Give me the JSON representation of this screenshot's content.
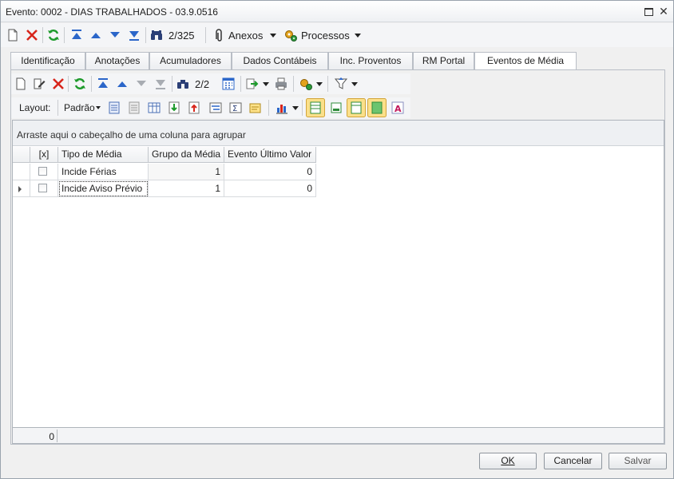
{
  "window": {
    "title": "Evento: 0002 - DIAS TRABALHADOS - 03.9.0516"
  },
  "toolbar": {
    "record_position": "2/325",
    "attachments_label": "Anexos",
    "processes_label": "Processos"
  },
  "tabs": [
    {
      "label": "Identificação"
    },
    {
      "label": "Anotações"
    },
    {
      "label": "Acumuladores"
    },
    {
      "label": "Dados Contábeis"
    },
    {
      "label": "Inc. Proventos"
    },
    {
      "label": "RM Portal"
    },
    {
      "label": "Eventos de Média"
    }
  ],
  "subtoolbar": {
    "record_position": "2/2",
    "layout_label": "Layout:",
    "layout_value": "Padrão"
  },
  "grid": {
    "group_hint": "Arraste aqui o cabeçalho de uma coluna para agrupar",
    "columns": [
      "[x]",
      "Tipo de Média",
      "Grupo da Média",
      "Evento Último Valor"
    ],
    "rows": [
      {
        "tipo": "Incide Férias",
        "grupo": "1",
        "evento": "0"
      },
      {
        "tipo": "Incide Aviso Prévio",
        "grupo": "1",
        "evento": "0"
      }
    ],
    "footer_count": "0"
  },
  "buttons": {
    "ok": "OK",
    "cancel": "Cancelar",
    "save": "Salvar"
  },
  "colors": {
    "accent_blue": "#2b66c9",
    "delete_red": "#d8261c",
    "refresh_green": "#1d9a2b"
  }
}
